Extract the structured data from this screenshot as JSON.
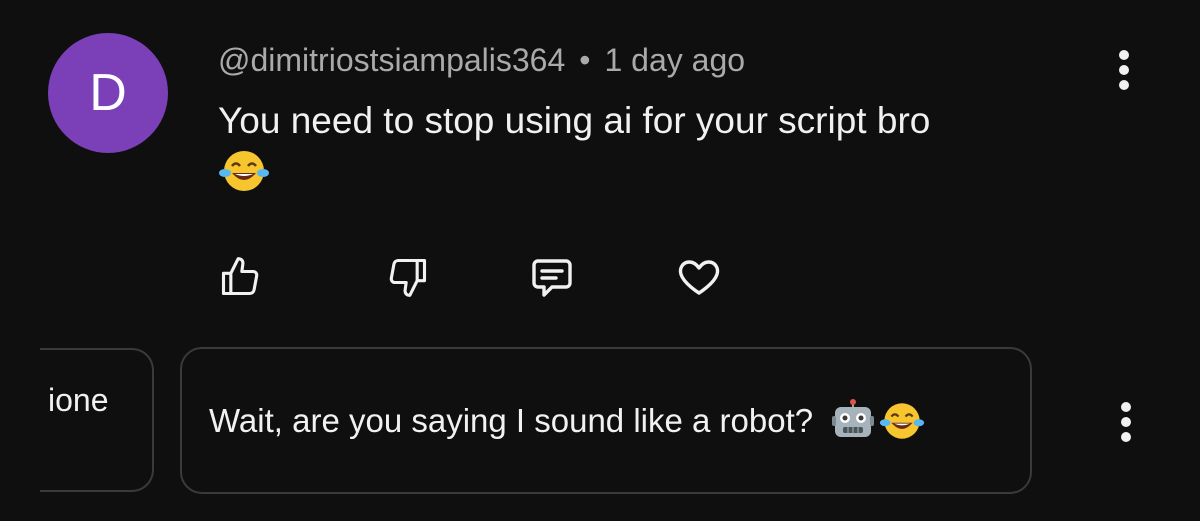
{
  "comment": {
    "avatar_letter": "D",
    "avatar_color": "#7b3fb8",
    "author": "@dimitriostsiampalis364",
    "separator": "•",
    "time": "1 day ago",
    "text": "You need to stop using ai for your script bro",
    "emoji": "laughing-tears-emoji"
  },
  "actions": [
    {
      "name": "like",
      "icon": "thumbs-up-icon"
    },
    {
      "name": "dislike",
      "icon": "thumbs-down-icon"
    },
    {
      "name": "reply",
      "icon": "comment-icon"
    },
    {
      "name": "heart",
      "icon": "heart-icon"
    }
  ],
  "suggestions": {
    "partial_chip_text": "ione",
    "main_chip_text": "Wait, are you saying I sound like a robot?",
    "main_chip_emojis": [
      "robot-emoji",
      "laughing-tears-emoji"
    ]
  },
  "menu_icon": "more-vertical-icon"
}
